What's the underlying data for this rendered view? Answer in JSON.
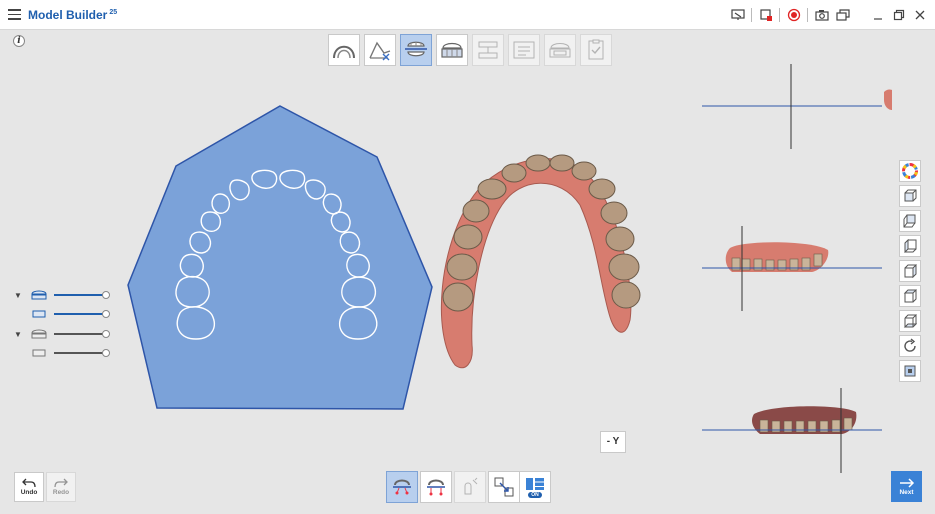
{
  "window": {
    "title": "Model Builder",
    "title_badge": "25",
    "controls": [
      "hamburger-icon",
      "screen-capture-icon",
      "crop-icon",
      "record-icon",
      "camera-icon",
      "layers-icon",
      "minimize-icon",
      "restore-icon",
      "close-icon"
    ]
  },
  "top_toolbar": {
    "tools": [
      {
        "name": "arch-tool",
        "state": "normal"
      },
      {
        "name": "trim-tool",
        "state": "normal"
      },
      {
        "name": "base-alignment-tool",
        "state": "active"
      },
      {
        "name": "base-tool",
        "state": "normal"
      },
      {
        "name": "articulator-tool",
        "state": "disabled"
      },
      {
        "name": "label-tool",
        "state": "disabled"
      },
      {
        "name": "hollow-tool",
        "state": "disabled"
      },
      {
        "name": "checklist-tool",
        "state": "disabled"
      }
    ]
  },
  "colors": {
    "accent": "#1f5fae",
    "occlusal_plane_fill": "#7ba2d9",
    "occlusal_plane_stroke": "#2e55a8",
    "active_tool": "#b8cfee",
    "next_button": "#3a82d6",
    "record_red": "#e02424"
  },
  "sliders": [
    {
      "name": "upper-model-slider",
      "expandable": true,
      "value": 1.0,
      "color": "blue"
    },
    {
      "name": "upper-base-slider",
      "expandable": false,
      "value": 1.0,
      "color": "blue"
    },
    {
      "name": "lower-model-slider",
      "expandable": true,
      "value": 1.0,
      "color": "gray"
    },
    {
      "name": "lower-base-slider",
      "expandable": false,
      "value": 1.0,
      "color": "gray"
    }
  ],
  "view_axis_label": "- Y",
  "actions": {
    "undo": "Undo",
    "redo": "Redo",
    "next": "Next"
  },
  "bottom_toolbar": {
    "tools": [
      {
        "name": "occlusal-plane-tool",
        "state": "active"
      },
      {
        "name": "arch-points-tool",
        "state": "normal"
      },
      {
        "name": "pen-tool",
        "state": "disabled"
      },
      {
        "name": "resize-tool",
        "state": "normal"
      }
    ],
    "toggle": {
      "name": "layout-toggle",
      "label": "ON"
    }
  },
  "right_toolbar": [
    "color-wheel-icon",
    "front-view-icon",
    "back-view-icon",
    "left-view-icon",
    "right-view-icon",
    "top-view-icon",
    "bottom-view-icon",
    "rotate-icon",
    "fit-view-icon"
  ]
}
